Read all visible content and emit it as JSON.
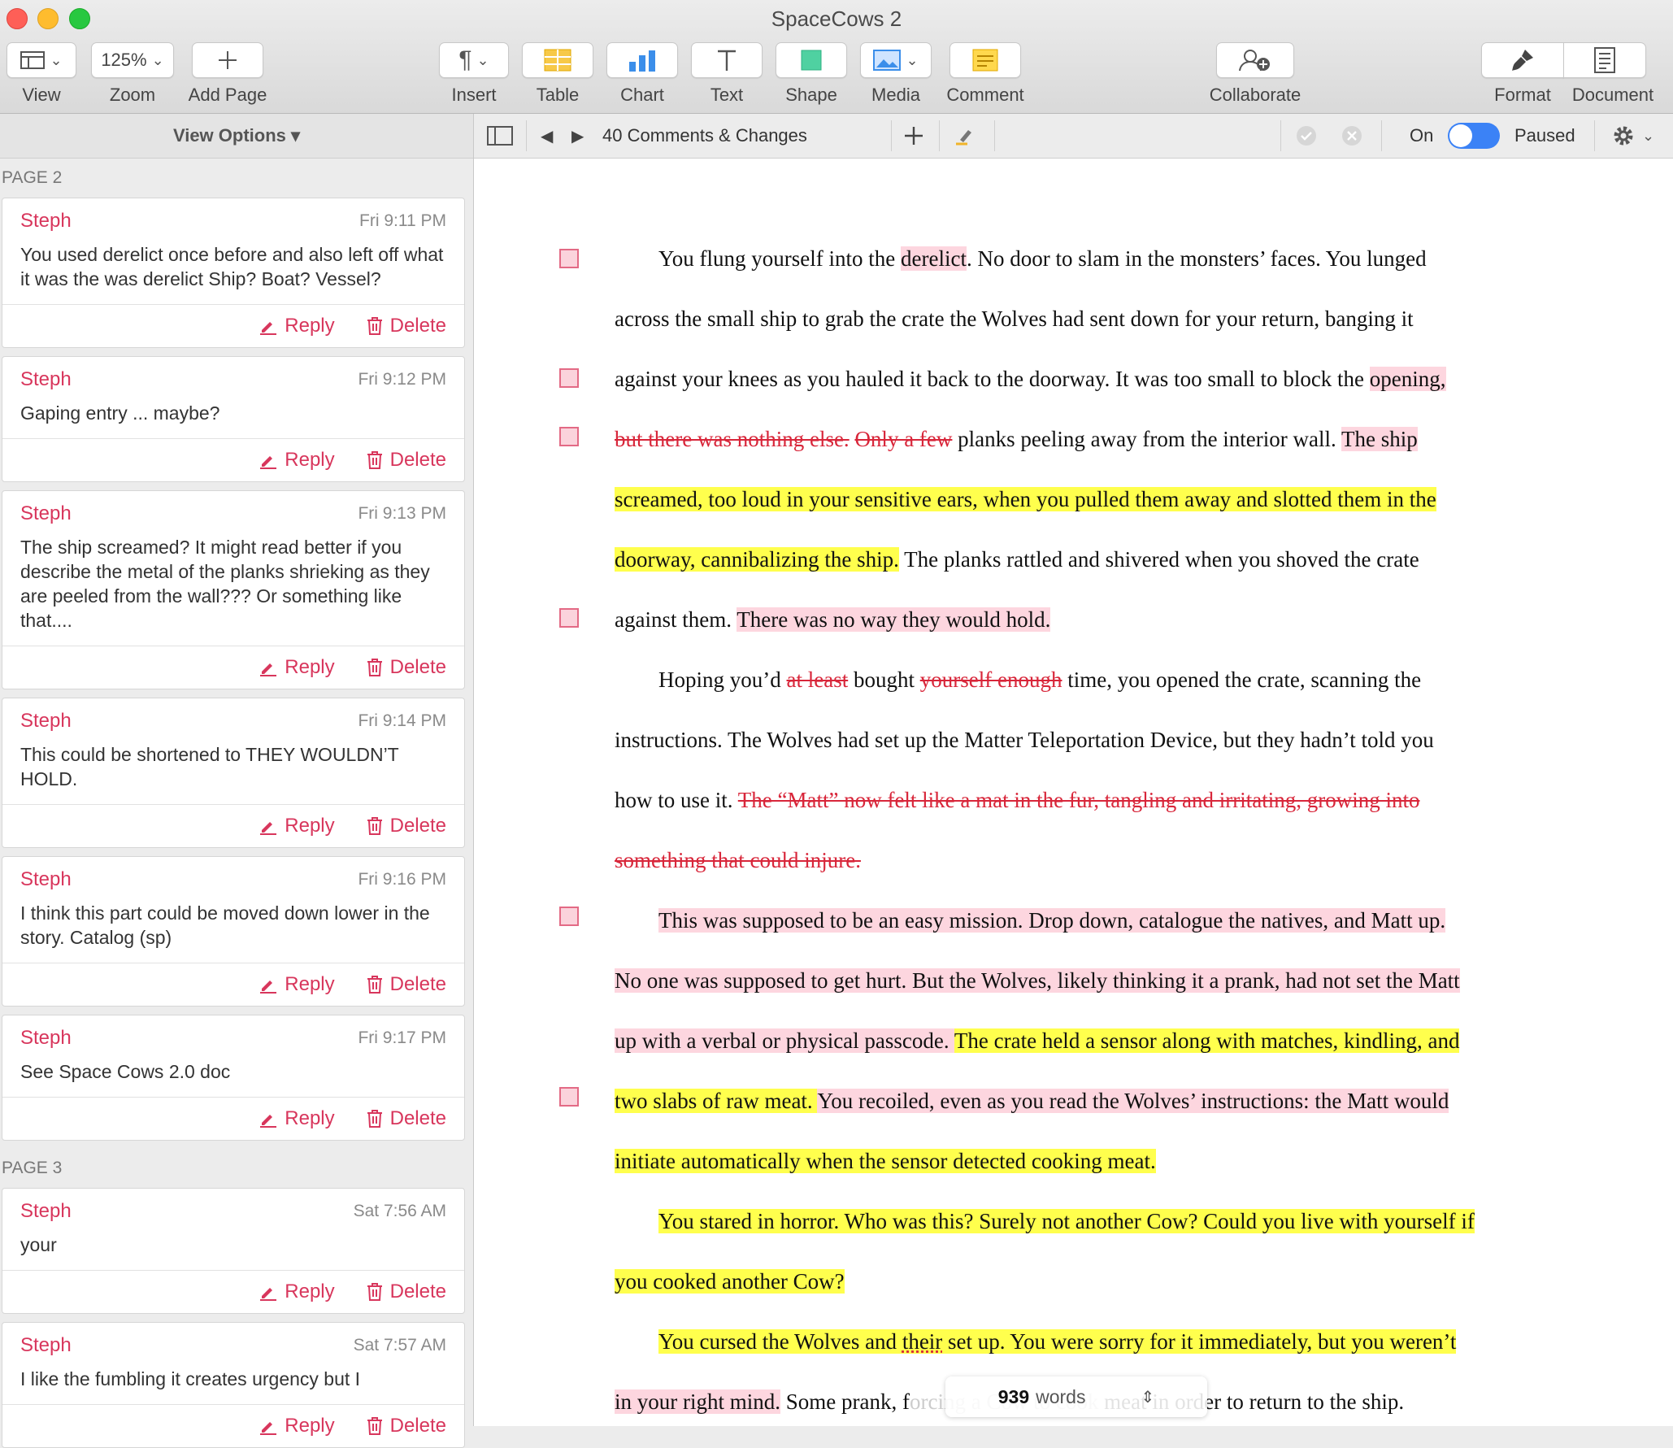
{
  "window": {
    "title": "SpaceCows 2"
  },
  "toolbar": {
    "view": "View",
    "zoom_value": "125%",
    "zoom": "Zoom",
    "add_page": "Add Page",
    "insert": "Insert",
    "table": "Table",
    "chart": "Chart",
    "text": "Text",
    "shape": "Shape",
    "media": "Media",
    "comment": "Comment",
    "collaborate": "Collaborate",
    "format": "Format",
    "document": "Document",
    "icons": {
      "view": "sidebar-icon",
      "add_page": "plus-icon",
      "insert": "pilcrow-icon",
      "table": "table-icon",
      "chart": "bar-chart-icon",
      "text": "text-icon",
      "shape": "square-icon",
      "media": "image-icon",
      "comment": "note-icon",
      "collaborate": "collaborate-icon",
      "format": "paintbrush-icon",
      "document": "document-icon"
    }
  },
  "sidebar": {
    "view_options": "View Options ▾",
    "pages": [
      {
        "label": "PAGE 2",
        "comments": [
          {
            "author": "Steph",
            "time": "Fri 9:11 PM",
            "text": "You used derelict once before and also left off what it was the was derelict Ship? Boat? Vessel?"
          },
          {
            "author": "Steph",
            "time": "Fri 9:12 PM",
            "text": "Gaping entry ... maybe?"
          },
          {
            "author": "Steph",
            "time": "Fri 9:13 PM",
            "text": "The ship screamed? It might read better if you describe the metal of the planks shrieking as they are peeled from the wall??? Or something like that...."
          },
          {
            "author": "Steph",
            "time": "Fri 9:14 PM",
            "text": "This could be shortened to THEY WOULDN’T HOLD."
          },
          {
            "author": "Steph",
            "time": "Fri 9:16 PM",
            "text": "I think this part could be moved down lower in the story. Catalog (sp)"
          },
          {
            "author": "Steph",
            "time": "Fri 9:17 PM",
            "text": "See Space Cows 2.0 doc"
          }
        ]
      },
      {
        "label": "PAGE 3",
        "comments": [
          {
            "author": "Steph",
            "time": "Sat 7:56 AM",
            "text": "your"
          },
          {
            "author": "Steph",
            "time": "Sat 7:57 AM",
            "text": "I like the fumbling it creates urgency but I"
          }
        ]
      }
    ],
    "reply_label": "Reply",
    "delete_label": "Delete"
  },
  "comments_bar": {
    "count_label": "40 Comments & Changes",
    "on_label": "On",
    "paused_label": "Paused",
    "accent": "#3b82f6"
  },
  "document": {
    "l1": {
      "a": "You flung yourself into the ",
      "b": "derelict",
      ".c": "",
      "c": ". No door to slam in the monsters’ faces. You lunged"
    },
    "l2": "across the small ship to grab the crate the Wolves had sent down for your return, banging it",
    "l3": {
      "a": "against your knees as you hauled it back to the doorway. It was too small to block the ",
      "b": "opening,"
    },
    "l4": {
      "d1": "but there was nothing else.",
      "sp": " ",
      "d2": "Only a few",
      "a": " planks peeling away from the interior wall. ",
      "b": "The ship"
    },
    "l5": "screamed, too loud in your sensitive ears, when you pulled them away and slotted them in the",
    "l6": {
      "b": "doorway, cannibalizing the ship.",
      "a": " The planks rattled and shivered when you shoved the crate"
    },
    "l7": {
      "a": "against them. ",
      "b": "There was no way they would hold. "
    },
    "l8": {
      "a": "Hoping you’d ",
      "d1": "at least",
      "b": " bought ",
      "d2": "yourself enough",
      "c": " time, you opened the crate, scanning the"
    },
    "l9": "instructions. The Wolves had set up the Matter Teleportation Device, but they hadn’t told you",
    "l10": {
      "a": "how to use it. ",
      "d": "The “Matt” now felt like a mat in the fur, tangling and irritating, growing into"
    },
    "l11": "something that could injure.",
    "l12": "This was supposed to be an easy mission. Drop down, catalogue the natives, and Matt up.",
    "l13": "No one was supposed to get hurt. But the Wolves, likely thinking it a prank, had not set the Matt",
    "l14": {
      "a": "up with a verbal or physical passcode. ",
      "b": "The crate held a sensor along with matches, kindling, and"
    },
    "l15": {
      "a": "two slabs of raw meat. ",
      "b": "You recoiled, even as you read the Wolves’ instructions: the Matt would"
    },
    "l16": "initiate automatically when the sensor detected cooking meat. ",
    "l17": "You stared in horror. Who was this? Surely not another Cow? Could you live with yourself if",
    "l18": "you cooked another Cow?",
    "l19": {
      "a": "You cursed the Wolves and ",
      "b": "their",
      "c": " set up. You were sorry for it immediately, but you weren’t"
    },
    "l20": {
      "a": "in your right mind.",
      "b": " Some prank, f",
      "c": "orcing a Cow to cook",
      "d": " meat in order to return to the ship."
    },
    "word_count": {
      "value": "939",
      "unit": "words"
    }
  }
}
